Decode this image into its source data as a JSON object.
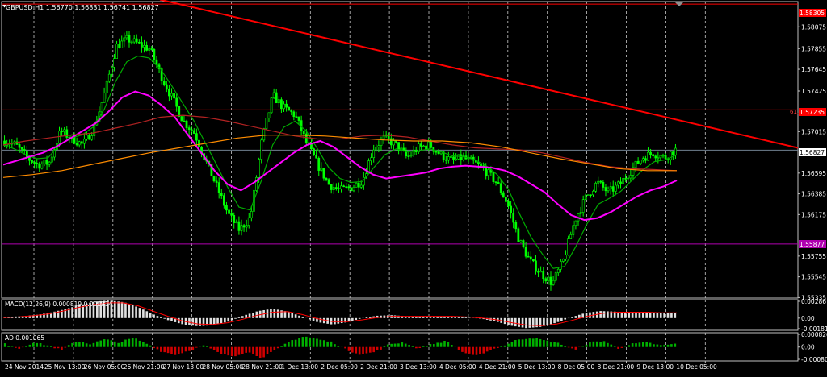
{
  "main_panel": {
    "title": "GBPUSD,H1  1.56770 1.56831 1.56741 1.56827",
    "y_ticks": [
      "1.58075",
      "1.57855",
      "1.57645",
      "1.57425",
      "1.57015",
      "1.56595",
      "1.56385",
      "1.56175",
      "1.55755",
      "1.55545",
      "1.55335"
    ],
    "price_tag_current": "1.56827",
    "price_tag_top": "1.58305",
    "price_tag_fib": "1.57235",
    "price_tag_low": "1.55877",
    "fib_label": "61.8",
    "colors": {
      "background": "#000000",
      "grid": "#c8c8c8",
      "candle": "#00ff00",
      "ma_fast": "#00aa00",
      "ma_magenta": "#ff00ff",
      "ma_brown": "#b22222",
      "ma_orange": "#ff8c00",
      "trendline": "#ff0000",
      "hline_red": "#ff0000",
      "hline_magenta": "#b000b0",
      "current_price_line": "#708090"
    }
  },
  "macd_panel": {
    "title": "MACD(12,26,9) 0.000819 0.000914",
    "y_ticks": [
      "0.00286",
      "0.00",
      "-0.00181"
    ]
  },
  "ad_panel": {
    "title": "AD 0.001065",
    "y_ticks": [
      "0.000826",
      "0.00",
      "-0.000802"
    ]
  },
  "x_axis": {
    "labels": [
      "24 Nov 2014",
      "25 Nov 13:00",
      "26 Nov 05:00",
      "26 Nov 21:00",
      "27 Nov 13:00",
      "28 Nov 05:00",
      "28 Nov 21:00",
      "1 Dec 13:00",
      "2 Dec 05:00",
      "2 Dec 21:00",
      "3 Dec 13:00",
      "4 Dec 05:00",
      "4 Dec 21:00",
      "5 Dec 13:00",
      "8 Dec 05:00",
      "8 Dec 21:00",
      "9 Dec 13:00",
      "10 Dec 05:00"
    ]
  },
  "chart_data": [
    {
      "type": "candlestick",
      "title": "GBPUSD,H1",
      "last_bar": {
        "open": 1.5677,
        "high": 1.56831,
        "low": 1.56741,
        "close": 1.56827
      },
      "ylim": [
        1.5533,
        1.5833
      ],
      "x": [
        "24 Nov 2014",
        "25 Nov 13:00",
        "26 Nov 05:00",
        "26 Nov 21:00",
        "27 Nov 13:00",
        "28 Nov 05:00",
        "28 Nov 21:00",
        "1 Dec 13:00",
        "2 Dec 05:00",
        "2 Dec 21:00",
        "3 Dec 13:00",
        "4 Dec 05:00",
        "4 Dec 21:00",
        "5 Dec 13:00",
        "8 Dec 05:00",
        "8 Dec 21:00",
        "9 Dec 13:00",
        "10 Dec 05:00"
      ],
      "price_path": [
        1.5692,
        1.5688,
        1.5675,
        1.5668,
        1.567,
        1.5702,
        1.5695,
        1.5688,
        1.5705,
        1.5742,
        1.5788,
        1.5795,
        1.579,
        1.5785,
        1.5758,
        1.5735,
        1.5712,
        1.57,
        1.5672,
        1.5645,
        1.5618,
        1.5602,
        1.5615,
        1.5692,
        1.5738,
        1.5725,
        1.5718,
        1.569,
        1.5668,
        1.5648,
        1.5642,
        1.5645,
        1.5652,
        1.5685,
        1.5695,
        1.5688,
        1.5675,
        1.5685,
        1.5688,
        1.5678,
        1.5672,
        1.5675,
        1.567,
        1.5662,
        1.565,
        1.5628,
        1.5592,
        1.557,
        1.5558,
        1.5548,
        1.5572,
        1.5612,
        1.5635,
        1.565,
        1.564,
        1.5648,
        1.5662,
        1.5675,
        1.568,
        1.5675,
        1.5683
      ],
      "series": [
        {
          "name": "MA fast",
          "color": "#00aa00",
          "values": [
            1.5688,
            1.5684,
            1.5678,
            1.5674,
            1.5675,
            1.5688,
            1.5695,
            1.5698,
            1.5706,
            1.5724,
            1.5752,
            1.5772,
            1.5778,
            1.5776,
            1.5765,
            1.5748,
            1.573,
            1.5712,
            1.569,
            1.5668,
            1.5645,
            1.5625,
            1.5622,
            1.5652,
            1.5688,
            1.5706,
            1.5712,
            1.5702,
            1.5684,
            1.5665,
            1.5654,
            1.565,
            1.5651,
            1.5665,
            1.5678,
            1.5684,
            1.5681,
            1.5682,
            1.5684,
            1.5681,
            1.5677,
            1.5676,
            1.5673,
            1.5667,
            1.5658,
            1.5643,
            1.5618,
            1.5595,
            1.5578,
            1.5563,
            1.5565,
            1.5585,
            1.5608,
            1.5628,
            1.5634,
            1.5641,
            1.5652,
            1.5663,
            1.5671,
            1.5673,
            1.5678
          ]
        },
        {
          "name": "MA magenta",
          "color": "#ff00ff",
          "values": [
            1.5668,
            1.5672,
            1.5676,
            1.568,
            1.5686,
            1.5694,
            1.5702,
            1.571,
            1.5722,
            1.5736,
            1.5742,
            1.5738,
            1.5728,
            1.5716,
            1.5698,
            1.568,
            1.5662,
            1.5648,
            1.5642,
            1.565,
            1.566,
            1.567,
            1.568,
            1.5688,
            1.5692,
            1.5686,
            1.5676,
            1.5666,
            1.5658,
            1.5654,
            1.5656,
            1.5658,
            1.566,
            1.5664,
            1.5666,
            1.5667,
            1.5666,
            1.5665,
            1.5662,
            1.5656,
            1.5648,
            1.564,
            1.5628,
            1.5617,
            1.5612,
            1.5614,
            1.562,
            1.5628,
            1.5636,
            1.5642,
            1.5646,
            1.5652
          ]
        },
        {
          "name": "MA brown",
          "color": "#b22222",
          "values": [
            1.5688,
            1.5692,
            1.5695,
            1.5698,
            1.57,
            1.5705,
            1.571,
            1.5716,
            1.5718,
            1.5716,
            1.5712,
            1.5707,
            1.5702,
            1.5697,
            1.5694,
            1.5694,
            1.5697,
            1.5698,
            1.5696,
            1.5692,
            1.5688,
            1.5685,
            1.5684,
            1.5683,
            1.568,
            1.5675,
            1.567,
            1.5666,
            1.5664,
            1.5663,
            1.5662
          ]
        },
        {
          "name": "MA orange",
          "color": "#ff8c00",
          "values": [
            1.5655,
            1.5658,
            1.5662,
            1.5668,
            1.5674,
            1.568,
            1.5685,
            1.569,
            1.5695,
            1.5698,
            1.5698,
            1.5697,
            1.5695,
            1.5693,
            1.5692,
            1.5692,
            1.569,
            1.5686,
            1.568,
            1.5674,
            1.5669,
            1.5664,
            1.5662,
            1.5662
          ]
        }
      ],
      "trendline": {
        "start": {
          "x": "26 Nov 21:00",
          "y": 1.5835
        },
        "end": {
          "x": "10 Dec 05:00",
          "y": 1.5685
        }
      },
      "horizontal_lines": [
        {
          "y": 1.58305,
          "color": "#ff0000"
        },
        {
          "y": 1.57235,
          "color": "#ff0000",
          "label": "61.8"
        },
        {
          "y": 1.55877,
          "color": "#b000b0"
        },
        {
          "y": 1.56827,
          "color": "#708090"
        }
      ]
    },
    {
      "type": "bar",
      "title": "MACD(12,26,9) 0.000819 0.000914",
      "ylim": [
        -0.00181,
        0.00286
      ],
      "histogram": [
        0.0002,
        0.0003,
        0.0005,
        0.0009,
        0.0015,
        0.0022,
        0.0028,
        0.003,
        0.0027,
        0.0018,
        0.0006,
        -0.0004,
        -0.0011,
        -0.0014,
        -0.0012,
        -0.0006,
        0.0004,
        0.0012,
        0.0016,
        0.0011,
        0.0002,
        -0.0007,
        -0.0011,
        -0.0007,
        0.0,
        0.0004,
        0.0005,
        0.0003,
        0.0002,
        0.0003,
        0.0003,
        0.0001,
        -0.0001,
        -0.0006,
        -0.0013,
        -0.0017,
        -0.0015,
        -0.0008,
        0.0001,
        0.0009,
        0.0012,
        0.0011,
        0.001,
        0.0009,
        0.0009,
        0.0008
      ],
      "signal": [
        0.0001,
        0.0002,
        0.0004,
        0.0007,
        0.0012,
        0.0018,
        0.0023,
        0.0026,
        0.0026,
        0.0021,
        0.0012,
        0.0003,
        -0.0005,
        -0.001,
        -0.0011,
        -0.0008,
        -0.0002,
        0.0005,
        0.001,
        0.0011,
        0.0006,
        -0.0001,
        -0.0006,
        -0.0006,
        -0.0003,
        0.0001,
        0.0003,
        0.0003,
        0.0003,
        0.0003,
        0.0003,
        0.0002,
        0.0,
        -0.0003,
        -0.0008,
        -0.0012,
        -0.0013,
        -0.001,
        -0.0004,
        0.0003,
        0.0008,
        0.001,
        0.001,
        0.001,
        0.0009,
        0.0009
      ]
    },
    {
      "type": "bar",
      "title": "AD 0.001065",
      "ylim": [
        -0.000802,
        0.000826
      ],
      "values": [
        0.0002,
        -0.0001,
        0.0003,
        0.0001,
        -0.0002,
        0.0004,
        0.0002,
        0.0005,
        0.0003,
        0.0006,
        0.0002,
        -0.0003,
        -0.0005,
        -0.0002,
        0.0001,
        -0.0004,
        -0.0006,
        -0.0003,
        -0.0007,
        -0.0002,
        0.0004,
        0.0007,
        0.0005,
        0.0003,
        -0.0002,
        -0.0005,
        -0.0003,
        0.0002,
        0.0003,
        -0.0001,
        0.0002,
        0.0004,
        -0.0003,
        -0.0006,
        -0.0002,
        0.0001,
        0.0005,
        0.0006,
        0.0004,
        0.0002,
        -0.0002,
        0.0003,
        0.0004,
        -0.0001,
        0.0002,
        0.0003,
        0.0001,
        0.0002
      ]
    }
  ]
}
